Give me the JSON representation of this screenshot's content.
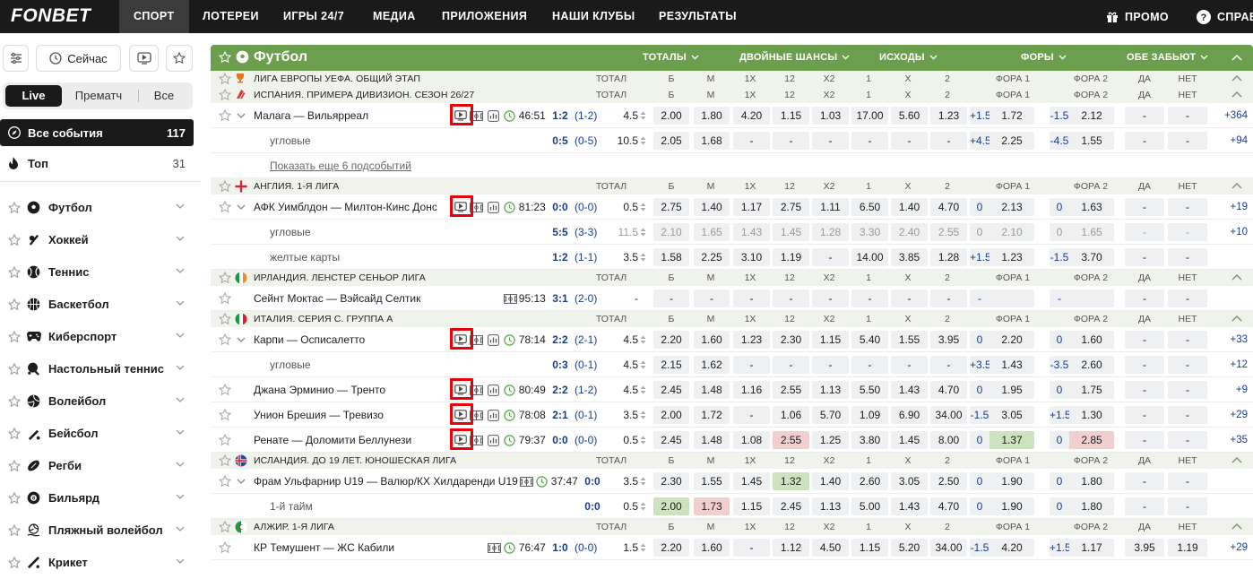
{
  "nav": {
    "logo": "FONBET",
    "items": [
      "СПОРТ",
      "ЛОТЕРЕИ",
      "ИГРЫ 24/7",
      "МЕДИА",
      "ПРИЛОЖЕНИЯ",
      "НАШИ КЛУБЫ",
      "РЕЗУЛЬТАТЫ"
    ],
    "promo": "ПРОМО",
    "help": "СПРАВ"
  },
  "sidebar": {
    "now_label": "Сейчас",
    "segments": [
      "Live",
      "Прематч",
      "Все"
    ],
    "all_events": {
      "label": "Все события",
      "count": "117"
    },
    "top": {
      "label": "Топ",
      "count": "31"
    },
    "sports": [
      "Футбол",
      "Хоккей",
      "Теннис",
      "Баскетбол",
      "Киберспорт",
      "Настольный теннис",
      "Волейбол",
      "Бейсбол",
      "Регби",
      "Бильярд",
      "Пляжный волейбол",
      "Крикет"
    ]
  },
  "main": {
    "title": "Футбол",
    "groups": [
      "ТОТАЛЫ",
      "ДВОЙНЫЕ ШАНСЫ",
      "ИСХОДЫ",
      "ФОРЫ",
      "ОБЕ ЗАБЬЮТ"
    ],
    "cols": [
      "ТОТАЛ",
      "Б",
      "М",
      "1Х",
      "12",
      "Х2",
      "1",
      "Х",
      "2",
      "ФОРА 1",
      "ФОРА 2",
      "ДА",
      "НЕТ"
    ],
    "cols_alt": [
      "ТОТАЛ",
      "Б",
      "М",
      "1Х",
      "12",
      "Х2",
      "1",
      "Х",
      "2",
      "ФОРА 1",
      "ФОРА 2",
      "ДА",
      "НЕТ"
    ],
    "rows": [
      {
        "t": "league",
        "name": "ЛИГА ЕВРОПЫ УЕФА. ОБЩИЙ ЭТАП",
        "flag": "uel"
      },
      {
        "t": "league",
        "name": "ИСПАНИЯ. ПРИМЕРА ДИВИЗИОН. СЕЗОН 26/27",
        "flag": "laliga"
      },
      {
        "t": "event",
        "name": "Малага — Вильярреал",
        "time": "46:51",
        "score": "1:2",
        "period": "(1-2)",
        "total": "4.5",
        "odds": [
          "2.00",
          "1.80",
          "4.20",
          "1.15",
          "1.03",
          "17.00",
          "5.60",
          "1.23",
          "+1.5",
          "1.72",
          "-1.5",
          "2.12",
          "-",
          "-"
        ],
        "more": "+364",
        "expand": true,
        "tv": true,
        "red": true
      },
      {
        "t": "sub",
        "name": "угловые",
        "score": "0:5",
        "period": "(0-5)",
        "total": "10.5",
        "odds": [
          "2.05",
          "1.68",
          "-",
          "-",
          "-",
          "-",
          "-",
          "-",
          "+4.5",
          "2.25",
          "-4.5",
          "1.55",
          "-",
          "-"
        ],
        "more": "+94"
      },
      {
        "t": "link",
        "name": "Показать еще 6 подсобытий"
      },
      {
        "t": "league",
        "name": "АНГЛИЯ. 1-Я ЛИГА",
        "flag": "eng"
      },
      {
        "t": "event",
        "name": "АФК Уимблдон — Милтон-Кинс Донс",
        "time": "81:23",
        "score": "0:0",
        "period": "(0-0)",
        "total": "0.5",
        "odds": [
          "2.75",
          "1.40",
          "1.17",
          "2.75",
          "1.11",
          "6.50",
          "1.40",
          "4.70",
          "0",
          "2.13",
          "0",
          "1.63",
          "-",
          "-"
        ],
        "more": "+19",
        "expand": true,
        "tv": true,
        "red": true
      },
      {
        "t": "sub",
        "name": "угловые",
        "score": "5:5",
        "period": "(3-3)",
        "total": "11.5",
        "odds": [
          "2.10",
          "1.65",
          "1.43",
          "1.45",
          "1.28",
          "3.30",
          "2.40",
          "2.55",
          "0",
          "2.10",
          "0",
          "1.65",
          "-",
          "-"
        ],
        "more": "+10",
        "faded": true
      },
      {
        "t": "sub",
        "name": "желтые карты",
        "score": "1:2",
        "period": "(1-1)",
        "total": "3.5",
        "odds": [
          "1.58",
          "2.25",
          "3.10",
          "1.19",
          "-",
          "14.00",
          "3.85",
          "1.28",
          "+1.5",
          "1.23",
          "-1.5",
          "3.70",
          "-",
          "-"
        ],
        "more": ""
      },
      {
        "t": "league",
        "name": "ИРЛАНДИЯ. ЛЕНСТЕР СЕНЬОР ЛИГА",
        "flag": "irl"
      },
      {
        "t": "event",
        "name": "Сейнт Моктас — Вэйсайд Селтик",
        "time": "95:13",
        "score": "3:1",
        "period": "(2-0)",
        "total": "-",
        "odds": [
          "-",
          "-",
          "-",
          "-",
          "-",
          "-",
          "-",
          "-",
          "-",
          "",
          "-",
          "",
          "-",
          "-"
        ],
        "more": "",
        "expand": false,
        "tv": false,
        "noclock": true
      },
      {
        "t": "league",
        "name": "ИТАЛИЯ. СЕРИЯ С. ГРУППА А",
        "flag": "ita"
      },
      {
        "t": "event",
        "name": "Карпи — Осписалетто",
        "time": "78:14",
        "score": "2:2",
        "period": "(2-1)",
        "total": "4.5",
        "odds": [
          "2.20",
          "1.60",
          "1.23",
          "2.30",
          "1.15",
          "5.40",
          "1.55",
          "3.95",
          "0",
          "2.20",
          "0",
          "1.60",
          "-",
          "-"
        ],
        "more": "+33",
        "expand": true,
        "tv": true,
        "red": true
      },
      {
        "t": "sub",
        "name": "угловые",
        "score": "0:3",
        "period": "(0-1)",
        "total": "4.5",
        "odds": [
          "2.15",
          "1.62",
          "-",
          "-",
          "-",
          "-",
          "-",
          "-",
          "+3.5",
          "1.43",
          "-3.5",
          "2.60",
          "-",
          "-"
        ],
        "more": "+12"
      },
      {
        "t": "event",
        "name": "Джана Эрминио — Тренто",
        "time": "80:49",
        "score": "2:2",
        "period": "(1-2)",
        "total": "4.5",
        "odds": [
          "2.45",
          "1.48",
          "1.16",
          "2.55",
          "1.13",
          "5.50",
          "1.43",
          "4.70",
          "0",
          "1.95",
          "0",
          "1.75",
          "-",
          "-"
        ],
        "more": "+9",
        "expand": false,
        "tv": true,
        "red": true
      },
      {
        "t": "event",
        "name": "Унион Брешия — Тревизо",
        "time": "78:08",
        "score": "2:1",
        "period": "(0-1)",
        "total": "3.5",
        "odds": [
          "2.00",
          "1.72",
          "-",
          "1.06",
          "5.70",
          "1.09",
          "6.90",
          "34.00",
          "-1.5",
          "3.05",
          "+1.5",
          "1.30",
          "-",
          "-"
        ],
        "more": "+29",
        "expand": false,
        "tv": true,
        "red": true
      },
      {
        "t": "event",
        "name": "Ренате — Доломити Беллунези",
        "time": "79:37",
        "score": "0:0",
        "period": "(0-0)",
        "total": "0.5",
        "odds": [
          "2.45",
          "1.48",
          "1.08",
          "2.55",
          "1.25",
          "3.80",
          "1.45",
          "8.00",
          "0",
          "1.37",
          "0",
          "2.85",
          "-",
          "-"
        ],
        "more": "+35",
        "expand": false,
        "tv": true,
        "red": true,
        "hl": {
          "3": "red",
          "9": "green",
          "11": "red"
        }
      },
      {
        "t": "league",
        "name": "ИСЛАНДИЯ. ДО 19 ЛЕТ. ЮНОШЕСКАЯ ЛИГА",
        "flag": "isl"
      },
      {
        "t": "event",
        "name": "Фрам Ульфарнир U19 — Валюр/КХ Хилдаренди U19",
        "time": "37:47",
        "score": "0:0",
        "period": "",
        "total": "3.5",
        "odds": [
          "2.30",
          "1.55",
          "1.45",
          "1.32",
          "1.40",
          "2.60",
          "3.05",
          "2.50",
          "0",
          "1.90",
          "0",
          "1.80",
          "-",
          "-"
        ],
        "more": "",
        "expand": true,
        "tv": false,
        "hl": {
          "3": "green"
        }
      },
      {
        "t": "sub",
        "name": "1-й тайм",
        "score": "0:0",
        "period": "",
        "total": "0.5",
        "odds": [
          "2.00",
          "1.73",
          "1.15",
          "2.45",
          "1.13",
          "5.00",
          "1.43",
          "4.70",
          "0",
          "1.90",
          "0",
          "1.80",
          "-",
          "-"
        ],
        "more": "",
        "hl": {
          "0": "green",
          "1": "red"
        }
      },
      {
        "t": "league",
        "name": "АЛЖИР. 1-Я ЛИГА",
        "flag": "alg"
      },
      {
        "t": "event",
        "name": "КР Темушент — ЖС Кабили",
        "time": "76:47",
        "score": "1:0",
        "period": "(0-0)",
        "total": "1.5",
        "odds": [
          "2.20",
          "1.60",
          "-",
          "1.12",
          "4.50",
          "1.15",
          "5.20",
          "34.00",
          "-1.5",
          "4.20",
          "+1.5",
          "1.17",
          "3.95",
          "1.19"
        ],
        "more": "+29",
        "expand": false,
        "tv": false
      }
    ]
  }
}
